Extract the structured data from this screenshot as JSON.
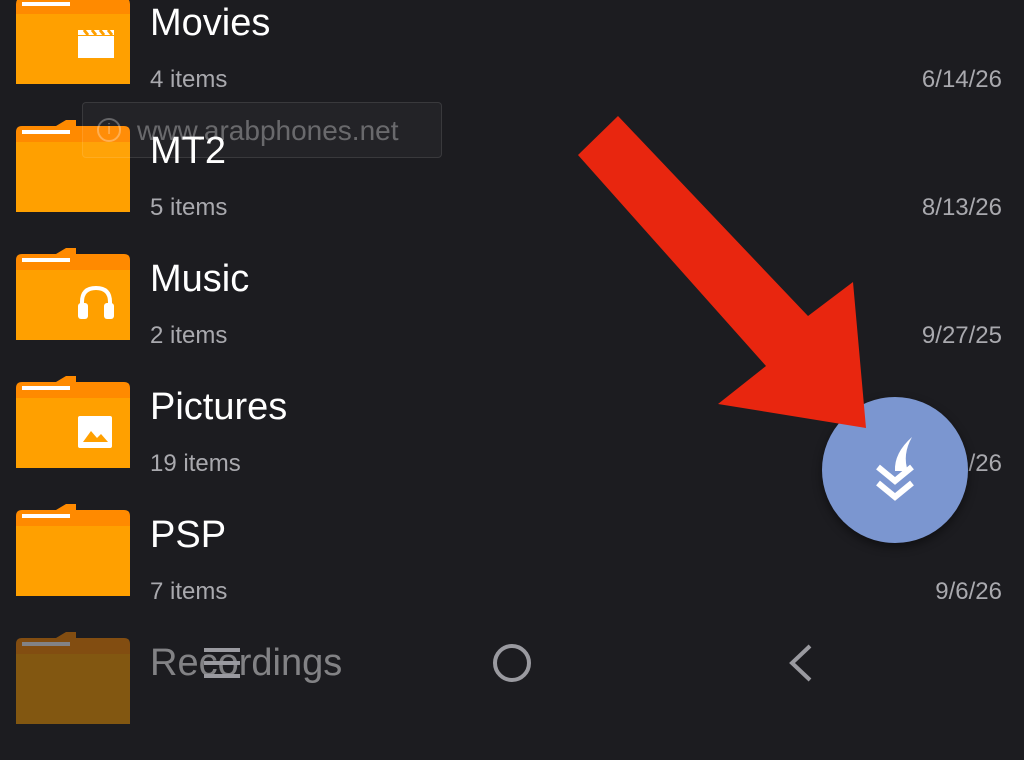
{
  "files": [
    {
      "name": "Movies",
      "count": "4 items",
      "date": "6/14/26",
      "icon": "clapperboard-icon"
    },
    {
      "name": "MT2",
      "count": "5 items",
      "date": "8/13/26",
      "icon": "none"
    },
    {
      "name": "Music",
      "count": "2 items",
      "date": "9/27/25",
      "icon": "headphones-icon"
    },
    {
      "name": "Pictures",
      "count": "19 items",
      "date": "/26",
      "icon": "image-icon"
    },
    {
      "name": "PSP",
      "count": "7 items",
      "date": "9/6/26",
      "icon": "none"
    },
    {
      "name": "Recordings",
      "count": "",
      "date": "",
      "icon": "none"
    }
  ],
  "watermark": {
    "text": "www.arabphones.net",
    "icon": "info-icon"
  },
  "fab": {
    "icon": "download-arrow-icon",
    "color": "#7b96d0"
  },
  "annotation": {
    "icon": "red-arrow-icon",
    "color": "#e8260f"
  },
  "navbar": {
    "buttons": [
      "menu-icon",
      "home-icon",
      "back-icon"
    ]
  },
  "colors": {
    "background": "#1c1c20",
    "folder": "#ffa000",
    "folder_tab": "#ff8a00",
    "text_primary": "#ffffff",
    "text_secondary": "#a9a9ae"
  }
}
